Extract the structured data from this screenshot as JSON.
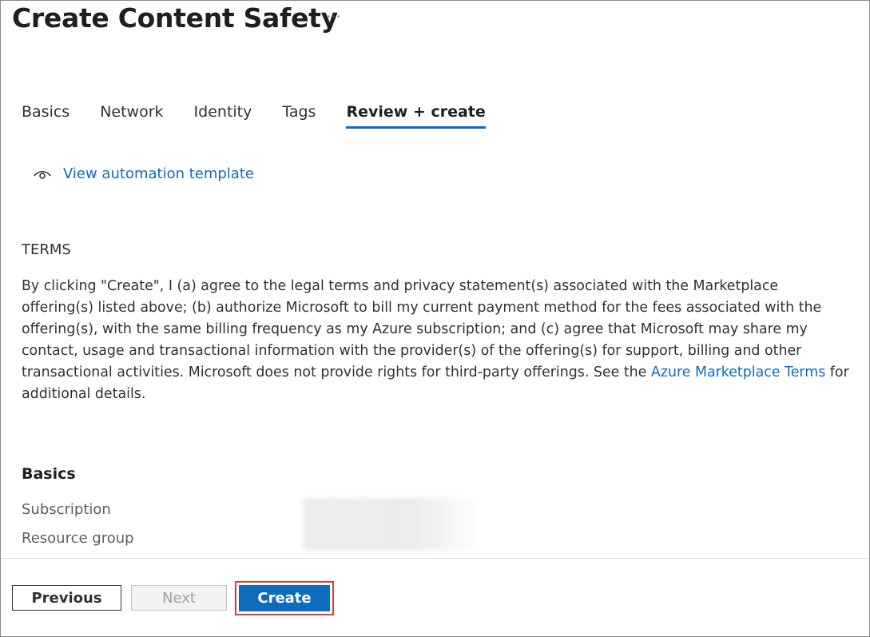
{
  "header": {
    "title": "Create Content Safety",
    "more_label": "···"
  },
  "tabs": [
    {
      "label": "Basics"
    },
    {
      "label": "Network"
    },
    {
      "label": "Identity"
    },
    {
      "label": "Tags"
    },
    {
      "label": "Review + create",
      "active": true
    }
  ],
  "automation": {
    "icon": "eye-icon",
    "link_label": "View automation template"
  },
  "terms": {
    "heading": "TERMS",
    "body_before_link": "By clicking \"Create\", I (a) agree to the legal terms and privacy statement(s) associated with the Marketplace offering(s) listed above; (b) authorize Microsoft to bill my current payment method for the fees associated with the offering(s), with the same billing frequency as my Azure subscription; and (c) agree that Microsoft may share my contact, usage and transactional information with the provider(s) of the offering(s) for support, billing and other transactional activities. Microsoft does not provide rights for third-party offerings. See the ",
    "link_label": "Azure Marketplace Terms",
    "body_after_link": " for additional details."
  },
  "basics": {
    "heading": "Basics",
    "fields": [
      {
        "label": "Subscription"
      },
      {
        "label": "Resource group"
      }
    ]
  },
  "footer": {
    "previous_label": "Previous",
    "next_label": "Next",
    "create_label": "Create"
  },
  "colors": {
    "accent": "#0f6cbd",
    "highlight_border": "#e03a3e"
  }
}
